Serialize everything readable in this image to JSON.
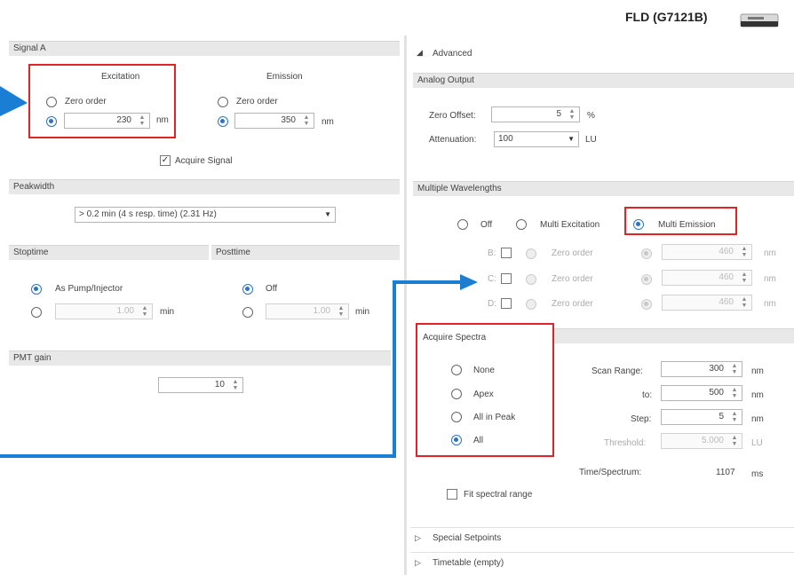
{
  "header": {
    "title": "FLD (G7121B)",
    "device_icon": "instrument-icon"
  },
  "signal_a": {
    "section_title": "Signal A",
    "excitation": {
      "title": "Excitation",
      "zero_order_label": "Zero order",
      "value": "230",
      "unit": "nm"
    },
    "emission": {
      "title": "Emission",
      "zero_order_label": "Zero order",
      "value": "350",
      "unit": "nm"
    },
    "acquire_signal_label": "Acquire Signal"
  },
  "peakwidth": {
    "section_title": "Peakwidth",
    "selected": "> 0.2 min (4 s resp. time) (2.31 Hz)"
  },
  "stoptime": {
    "section_title": "Stoptime",
    "option_label": "As Pump/Injector",
    "value": "1.00",
    "unit": "min"
  },
  "posttime": {
    "section_title": "Posttime",
    "option_label": "Off",
    "value": "1.00",
    "unit": "min"
  },
  "pmt_gain": {
    "section_title": "PMT gain",
    "value": "10"
  },
  "advanced": {
    "title": "Advanced",
    "analog_output": {
      "section_title": "Analog Output",
      "zero_offset_label": "Zero Offset:",
      "zero_offset_value": "5",
      "zero_offset_unit": "%",
      "attenuation_label": "Attenuation:",
      "attenuation_value": "100",
      "attenuation_unit": "LU"
    },
    "multiple_wavelengths": {
      "section_title": "Multiple Wavelengths",
      "off_label": "Off",
      "multi_excitation_label": "Multi Excitation",
      "multi_emission_label": "Multi Emission",
      "rows": [
        {
          "label": "B:",
          "zero_order": "Zero order",
          "value": "460",
          "unit": "nm"
        },
        {
          "label": "C:",
          "zero_order": "Zero order",
          "value": "460",
          "unit": "nm"
        },
        {
          "label": "D:",
          "zero_order": "Zero order",
          "value": "460",
          "unit": "nm"
        }
      ]
    },
    "acquire_spectra": {
      "section_title": "Acquire Spectra",
      "options": [
        "None",
        "Apex",
        "All in Peak",
        "All"
      ],
      "scan_range_label": "Scan Range:",
      "scan_range_value": "300",
      "to_label": "to:",
      "to_value": "500",
      "step_label": "Step:",
      "step_value": "5",
      "threshold_label": "Threshold:",
      "threshold_value": "5.000",
      "nm": "nm",
      "lu": "LU",
      "time_spectrum_label": "Time/Spectrum:",
      "time_spectrum_value": "1107",
      "time_spectrum_unit": "ms",
      "fit_label": "Fit spectral range"
    },
    "special_setpoints": "Special Setpoints",
    "timetable": "Timetable (empty)"
  },
  "colors": {
    "annotation_red": "#e02424",
    "annotation_blue": "#1a7fd4",
    "radio_blue": "#2c74c2"
  }
}
